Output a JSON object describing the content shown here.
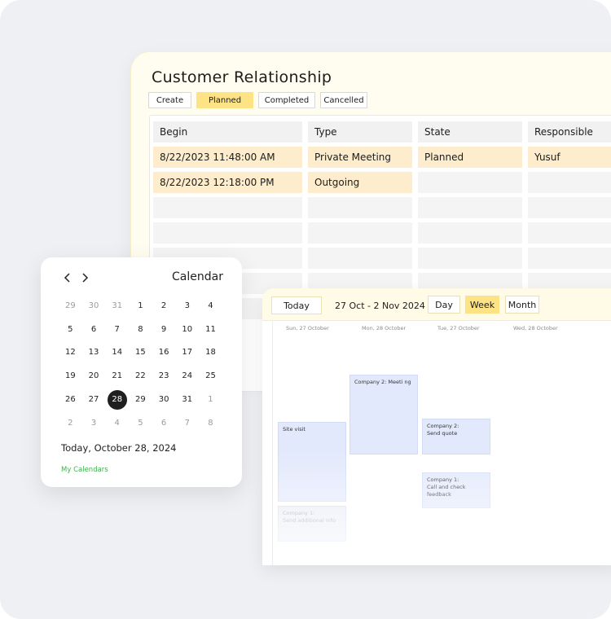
{
  "crm": {
    "title": "Customer Relationship",
    "filters": [
      "Create",
      "Planned",
      "Completed",
      "Cancelled"
    ],
    "active_filter": "Planned",
    "columns": [
      "Begin",
      "Type",
      "State",
      "Responsible"
    ],
    "rows": [
      [
        "8/22/2023 11:48:00 AM",
        "Private Meeting",
        "Planned",
        "Yusuf"
      ],
      [
        "8/22/2023 12:18:00 PM",
        "Outgoing",
        "",
        ""
      ]
    ]
  },
  "week": {
    "today_label": "Today",
    "range": "27 Oct - 2 Nov 2024",
    "views": [
      "Day",
      "Week",
      "Month"
    ],
    "active_view": "Week",
    "day_headers": [
      "Sun, 27 October",
      "Mon, 28 October",
      "Tue, 27 October",
      "Wed, 28 October"
    ],
    "events": [
      {
        "text": "Company 2: Meeti ng"
      },
      {
        "text": "Site visit"
      },
      {
        "text": "Company 2:\nSend quote"
      },
      {
        "text": "Company 1:\nCall and check\nfeedback"
      },
      {
        "text": "Company 1:\nSend additional info"
      }
    ]
  },
  "calendar": {
    "title": "Calendar",
    "prev_icon": "chevron-left-icon",
    "next_icon": "chevron-right-icon",
    "days": [
      "29",
      "30",
      "31",
      "1",
      "2",
      "3",
      "4",
      "5",
      "6",
      "7",
      "8",
      "9",
      "10",
      "11",
      "12",
      "13",
      "14",
      "15",
      "16",
      "17",
      "18",
      "19",
      "20",
      "21",
      "22",
      "23",
      "24",
      "25",
      "26",
      "27",
      "28",
      "29",
      "30",
      "31",
      "1",
      "2",
      "3",
      "4",
      "5",
      "6",
      "7",
      "8"
    ],
    "selected_day": "28",
    "today_text": "Today, October 28, 2024",
    "my_calendars": "My Calendars",
    "accent_green": "#3cb54a",
    "accent_yellow": "#fde383"
  }
}
